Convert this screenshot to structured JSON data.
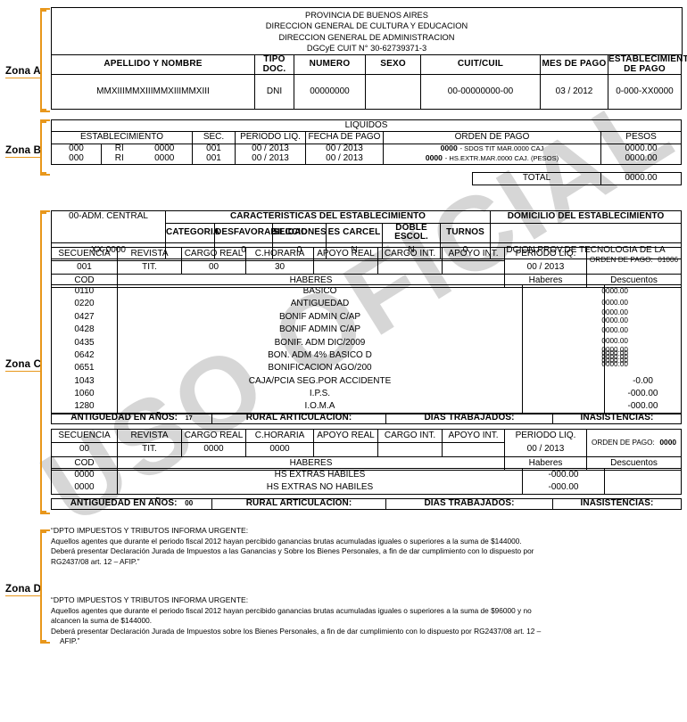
{
  "zones": {
    "a": "Zona A",
    "b": "Zona B",
    "c": "Zona C",
    "d": "Zona D"
  },
  "watermark": "USO OFICIAL",
  "header": {
    "line1": "PROVINCIA DE BUENOS AIRES",
    "line2": "DIRECCION GENERAL DE CULTURA Y EDUCACION",
    "line3": "DIRECCION GENERAL DE ADMINISTRACION",
    "line4": "DGCyE CUIT N° 30-62739371-3"
  },
  "zona_a": {
    "columns": [
      "APELLIDO Y NOMBRE",
      "TIPO DOC.",
      "NUMERO",
      "SEXO",
      "CUIT/CUIL",
      "MES DE PAGO",
      "ESTABLECIMIENTO DE PAGO"
    ],
    "values": {
      "apellido_y_nombre": "MMXIIIMMXIIIMMXIIIMMXIII",
      "tipo_doc": "DNI",
      "numero": "00000000",
      "sexo": "",
      "cuit_cuil": "00-00000000-00",
      "mes_de_pago": "03 / 2012",
      "establecimiento_de_pago": "0-000-XX0000"
    }
  },
  "zona_b": {
    "title": "LIQUIDOS",
    "columns": [
      "ESTABLECIMIENTO",
      "SEC.",
      "PERIODO LIQ.",
      "FECHA DE PAGO",
      "ORDEN DE PAGO",
      "PESOS"
    ],
    "rows": [
      {
        "est_num": "000",
        "est_cod": "RI",
        "est_id": "0000",
        "sec": "001",
        "periodo_liq": "00 / 2013",
        "fecha_de_pago": "00 / 2013",
        "orden_num": "0000",
        "orden_desc": "- SDOS TIT MAR.0000 CAJ",
        "pesos": "0000.00"
      },
      {
        "est_num": "000",
        "est_cod": "RI",
        "est_id": "0000",
        "sec": "001",
        "periodo_liq": "00 / 2013",
        "fecha_de_pago": "00 / 2013",
        "orden_num": "0000",
        "orden_desc": "- HS.EXTR.MAR.0000 CAJ. (PESOS)",
        "pesos": "0000.00"
      }
    ],
    "total_label": "TOTAL",
    "total_value": "0000.00"
  },
  "zona_c": {
    "establecimiento_nombre": "00-ADM. CENTRAL",
    "establecimiento_codigo": "XX-0000",
    "caracteristicas_title": "CARACTERISTICAS DEL ESTABLECIMIENTO",
    "domicilio_title": "DOMICILIO DEL ESTABLECIMIENTO",
    "domicilio_valor": "DCION.PROV.DE TECNOLOGIA DE LA",
    "caracteristicas": [
      {
        "label": "CATEGORIA",
        "value": ""
      },
      {
        "label": "DESFAVORABILIDAD",
        "value": "0"
      },
      {
        "label": "SECCIONES",
        "value": "0"
      },
      {
        "label": "ES CARCEL",
        "value": "N"
      },
      {
        "label": "DOBLE ESCOL.",
        "value": "N"
      },
      {
        "label": "TURNOS",
        "value": "0"
      }
    ],
    "seq_columns": [
      "SECUENCIA",
      "REVISTA",
      "CARGO REAL",
      "C.HORARIA",
      "APOYO REAL",
      "CARGO INT.",
      "APOYO INT.",
      "PERIODO LIQ."
    ],
    "orden_de_pago_label": "ORDEN DE PAGO:",
    "cod_label": "COD",
    "haberes_label": "HABERES",
    "haberes_col": "Haberes",
    "descuentos_col": "Descuentos",
    "footer_labels": {
      "antiguedad": "ANTIGUEDAD EN AÑOS:",
      "rural": "RURAL ARTICULACION:",
      "dias": "DIAS TRABAJADOS:",
      "inasistencias": "INASISTENCIAS:"
    },
    "block1": {
      "secuencia": "001",
      "revista": "TIT.",
      "cargo_real": "00",
      "c_horaria": "30",
      "apoyo_real": "",
      "cargo_int": "",
      "apoyo_int": "",
      "periodo_liq": "00 / 2013",
      "orden_de_pago": "01006",
      "antiguedad": "17",
      "rural": "",
      "dias": "",
      "inasistencias": "",
      "conceptos": [
        {
          "cod": "0110",
          "desc": "BASICO",
          "haberes": "0000.00",
          "descuentos": ""
        },
        {
          "cod": "0220",
          "desc": "ANTIGUEDAD",
          "haberes": "0000.00",
          "descuentos": ""
        },
        {
          "cod": "0427",
          "desc": "BONIF ADMIN C/AP",
          "haberes": "0000.00",
          "descuentos": ""
        },
        {
          "cod": "0428",
          "desc": "BONIF ADMIN C/AP",
          "haberes": "0000.00",
          "descuentos": ""
        },
        {
          "cod": "0435",
          "desc": "BONIF. ADM DIC/2009",
          "haberes": "0000.00",
          "descuentos": ""
        },
        {
          "cod": "0642",
          "desc": "BON. ADM 4% BASICO D",
          "haberes": "0000.00",
          "descuentos": ""
        },
        {
          "cod": "0651",
          "desc": "BONIFICACION AGO/200",
          "haberes": "0000.00",
          "descuentos": ""
        },
        {
          "cod": "1043",
          "desc": "CAJA/PCIA SEG.POR ACCIDENTE",
          "haberes": "",
          "descuentos": "-0.00"
        },
        {
          "cod": "1060",
          "desc": "I.P.S.",
          "haberes": "",
          "descuentos": "-000.00"
        },
        {
          "cod": "1280",
          "desc": "I.O.M.A",
          "haberes": "",
          "descuentos": "-000.00"
        }
      ],
      "haberes_overlap": [
        "0000.00",
        "0000.00",
        "0000.00",
        "0000.00",
        "0000.00",
        "0000.00",
        "0000.00",
        "0000.00",
        "0000.00",
        "0000.00",
        "0000.00"
      ]
    },
    "block2": {
      "secuencia": "00",
      "revista": "TIT.",
      "cargo_real": "0000",
      "c_horaria": "0000",
      "apoyo_real": "",
      "cargo_int": "",
      "apoyo_int": "",
      "periodo_liq": "00 / 2013",
      "orden_de_pago": "0000",
      "antiguedad": "00",
      "rural": "",
      "dias": "",
      "inasistencias": "",
      "conceptos": [
        {
          "cod": "0000",
          "desc": "HS EXTRAS HABILES",
          "haberes": "-000.00",
          "descuentos": ""
        },
        {
          "cod": "0000",
          "desc": "HS EXTRAS NO HABILES",
          "haberes": "-000.00",
          "descuentos": ""
        }
      ]
    }
  },
  "zona_d": {
    "note1": {
      "title": "“DPTO IMPUESTOS Y TRIBUTOS INFORMA URGENTE:",
      "line1": "Aquellos agentes que durante el periodo fiscal 2012 hayan percibido ganancias brutas acumuladas iguales o superiores a la suma de $144000.",
      "line2": "Deberá presentar Declaración Jurada de Impuestos a las Ganancias y Sobre los Bienes Personales, a fin de dar cumplimiento con lo dispuesto por",
      "line3": "RG2437/08 art. 12 – AFIP.”"
    },
    "note2": {
      "title": "“DPTO IMPUESTOS Y TRIBUTOS INFORMA URGENTE:",
      "line1": "Aquellos agentes que durante el periodo fiscal 2012 hayan percibido ganancias brutas acumuladas iguales o superiores a la suma de $96000 y no",
      "line2": "alcancen la suma de $144000.",
      "line3": "Deberá presentar Declaración Jurada de Impuestos sobre los Bienes Personales, a fin de dar cumplimiento con lo dispuesto por RG2437/08 art. 12 –",
      "line4": "AFIP.”"
    }
  },
  "colors": {
    "accent": "#E8971B",
    "watermark": "#c9c9c9",
    "ink": "#000000"
  }
}
